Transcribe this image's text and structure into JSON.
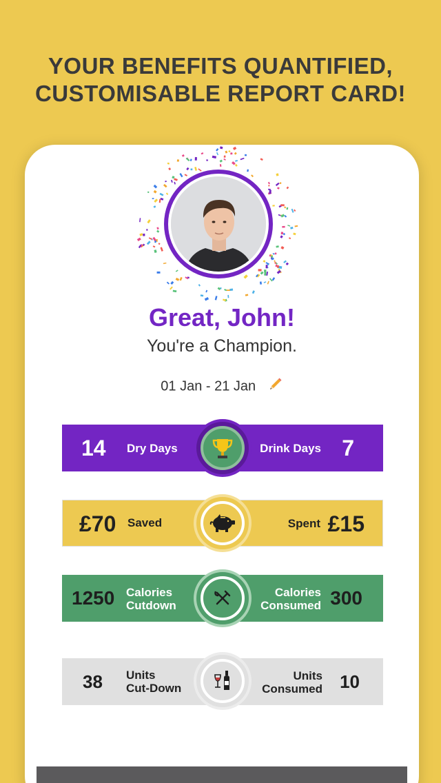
{
  "headline": {
    "line1": "YOUR BENEFITS QUANTIFIED,",
    "line2": "CUSTOMISABLE REPORT CARD!"
  },
  "profile": {
    "greeting": "Great, John!",
    "subtitle": "You're a Champion.",
    "date_range": "01 Jan - 21 Jan"
  },
  "stats": {
    "days": {
      "left_value": "14",
      "left_label": "Dry Days",
      "right_label": "Drink Days",
      "right_value": "7",
      "icon": "trophy-icon",
      "color": "#7325C3"
    },
    "money": {
      "left_value": "£70",
      "left_label": "Saved",
      "right_label": "Spent",
      "right_value": "£15",
      "icon": "piggy-bank-icon",
      "color": "#EDC951"
    },
    "calories": {
      "left_value": "1250",
      "left_label_1": "Calories",
      "left_label_2": "Cutdown",
      "right_label_1": "Calories",
      "right_label_2": "Consumed",
      "right_value": "300",
      "icon": "fork-knife-icon",
      "color": "#4F9E6B"
    },
    "units": {
      "left_value": "38",
      "left_label_1": "Units",
      "left_label_2": "Cut-Down",
      "right_label_1": "Units",
      "right_label_2": "Consumed",
      "right_value": "10",
      "icon": "wine-bottle-glass-icon",
      "color": "#E0E0E0"
    }
  }
}
